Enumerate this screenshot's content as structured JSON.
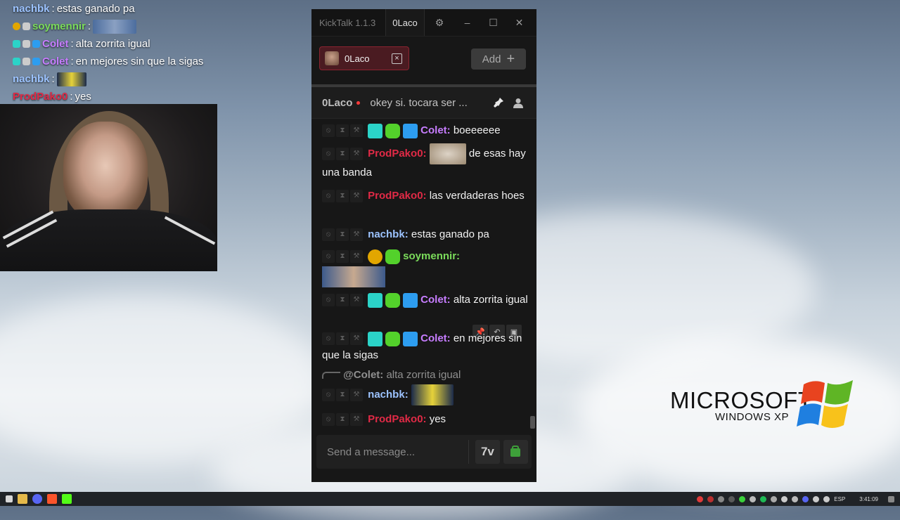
{
  "overlay_chat": [
    {
      "user": "nachbk",
      "color": "#9cc3ff",
      "text": "estas ganado pa",
      "badges": [],
      "emote": false
    },
    {
      "user": "soymennir",
      "color": "#7bdc5b",
      "text": "",
      "badges": [
        "gold-badge",
        "message-icon"
      ],
      "emote": true
    },
    {
      "user": "Colet",
      "color": "#c77dff",
      "text": "alta zorrita igual",
      "badges": [
        "og-badge",
        "message-icon",
        "cube-badge"
      ],
      "emote": false
    },
    {
      "user": "Colet",
      "color": "#c77dff",
      "text": "en mejores sin que la sigas",
      "badges": [
        "og-badge",
        "message-icon",
        "cube-badge"
      ],
      "emote": false
    },
    {
      "user": "nachbk",
      "color": "#9cc3ff",
      "text": "",
      "badges": [],
      "emote": true
    },
    {
      "user": "ProdPako0",
      "color": "#e02a46",
      "text": "yes",
      "badges": [],
      "emote": false
    }
  ],
  "app": {
    "name": "KickTalk 1.1.3",
    "current_user": "0Laco",
    "window_controls": {
      "minimize": "–",
      "maximize": "☐",
      "close": "✕"
    }
  },
  "tabs": {
    "channel": "0Laco",
    "add_label": "Add",
    "add_icon": "+"
  },
  "chat_header": {
    "channel": "0Laco",
    "stream_title": "okey si. tocara ser ..."
  },
  "messages": [
    {
      "user": "Colet",
      "color": "#c77dff",
      "text": "boeeeeee"
    },
    {
      "user": "ProdPako0",
      "color": "#e02a46",
      "text": "de esas hay una banda"
    },
    {
      "user": "ProdPako0",
      "color": "#e02a46",
      "text": "las verdaderas hoes"
    },
    {
      "user": "nachbk",
      "color": "#9cc3ff",
      "text": "estas ganado pa"
    },
    {
      "user": "soymennir",
      "color": "#7bdc5b",
      "text": ""
    },
    {
      "user": "Colet",
      "color": "#c77dff",
      "text": "alta zorrita igual"
    },
    {
      "user": "Colet",
      "color": "#c77dff",
      "text": "en mejores sin que la sigas"
    },
    {
      "user": "nachbk",
      "color": "#9cc3ff",
      "text": "",
      "reply_to": "@Colet:",
      "reply_text": "alta zorrita igual"
    },
    {
      "user": "ProdPako0",
      "color": "#e02a46",
      "text": "yes"
    }
  ],
  "input": {
    "placeholder": "Send a message...",
    "emote_button": "7v"
  },
  "desktop": {
    "logo_word": "MICROSOFT",
    "logo_sub": "WINDOWS XP"
  },
  "taskbar": {
    "language": "ESP",
    "time": "3:41:09"
  }
}
